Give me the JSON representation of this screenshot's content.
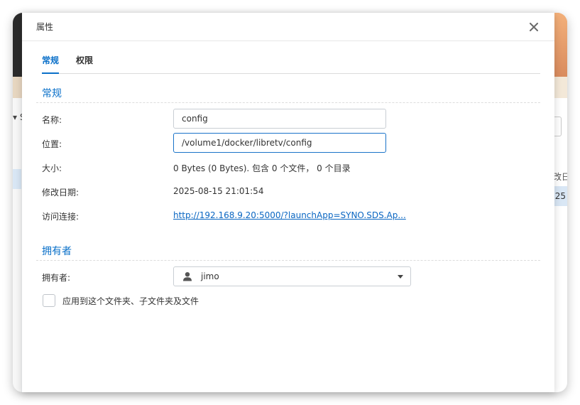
{
  "dialog": {
    "title": "属性",
    "close_symbol": "✕"
  },
  "tabs": [
    {
      "label": "常规",
      "active": true
    },
    {
      "label": "权限",
      "active": false
    }
  ],
  "general": {
    "section_title": "常规",
    "name_label": "名称:",
    "name_value": "config",
    "location_label": "位置:",
    "location_value": "/volume1/docker/libretv/config",
    "size_label": "大小:",
    "size_value": "0 Bytes (0 Bytes). 包含 0 个文件， 0 个目录",
    "modified_label": "修改日期:",
    "modified_value": "2025-08-15 21:01:54",
    "link_label": "访问连接:",
    "link_value": "http://192.168.9.20:5000/?launchApp=SYNO.SDS.Ap..."
  },
  "owner": {
    "section_title": "拥有者",
    "owner_label": "拥有者:",
    "owner_value": "jimo",
    "owner_icon": "user-icon",
    "apply_label": "应用到这个文件夹、子文件夹及文件",
    "apply_checked": false
  },
  "background": {
    "right_col_header": "改日",
    "right_col_value": "25",
    "left_mark": "▾ S"
  },
  "colors": {
    "accent": "#0a70c9",
    "link": "#0a66c2",
    "selected_row": "#d9e7f5"
  }
}
